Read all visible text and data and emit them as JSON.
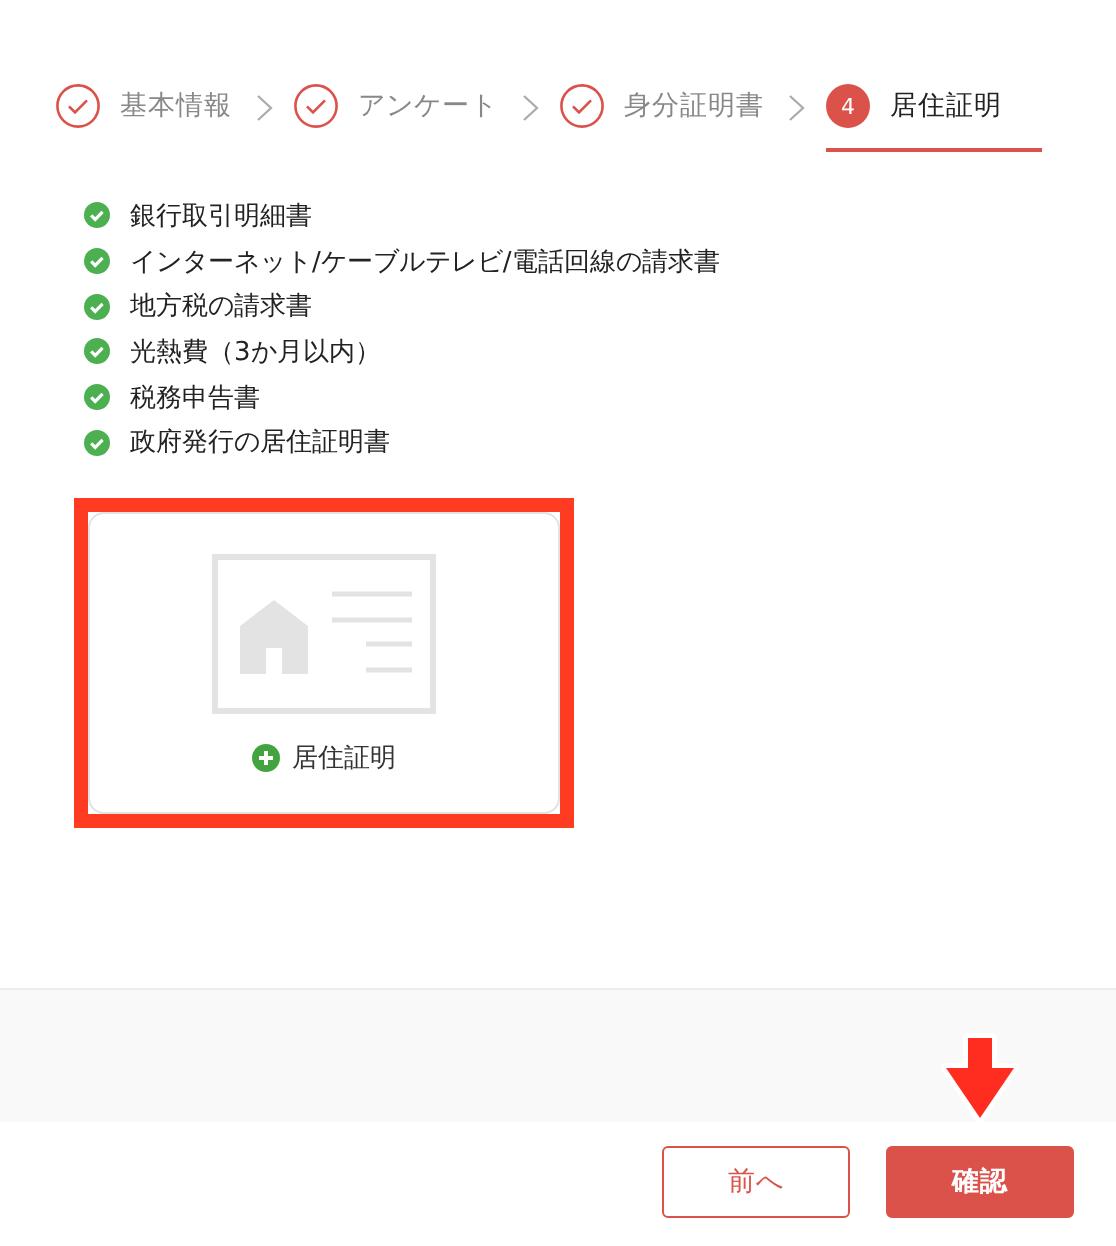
{
  "steps": [
    {
      "label": "基本情報",
      "completed": true,
      "selected": false
    },
    {
      "label": "アンケート",
      "completed": true,
      "selected": false
    },
    {
      "label": "身分証明書",
      "completed": true,
      "selected": false
    },
    {
      "label": "居住証明",
      "completed": false,
      "number": "4",
      "selected": true
    }
  ],
  "documents": [
    {
      "text": "銀行取引明細書",
      "checked": true
    },
    {
      "text": "インターネット/ケーブルテレビ/電話回線の請求書",
      "checked": true
    },
    {
      "text": "地方税の請求書",
      "checked": true
    },
    {
      "text": "光熱費（3か月以内）",
      "checked": true
    },
    {
      "text": "税務申告書",
      "checked": true
    },
    {
      "text": "政府発行の居住証明書",
      "checked": true
    }
  ],
  "upload": {
    "label": "居住証明",
    "highlighted": true
  },
  "buttons": [
    {
      "label": "前へ",
      "kind": "secondary"
    },
    {
      "label": "確認",
      "kind": "primary",
      "pointed": true
    }
  ]
}
